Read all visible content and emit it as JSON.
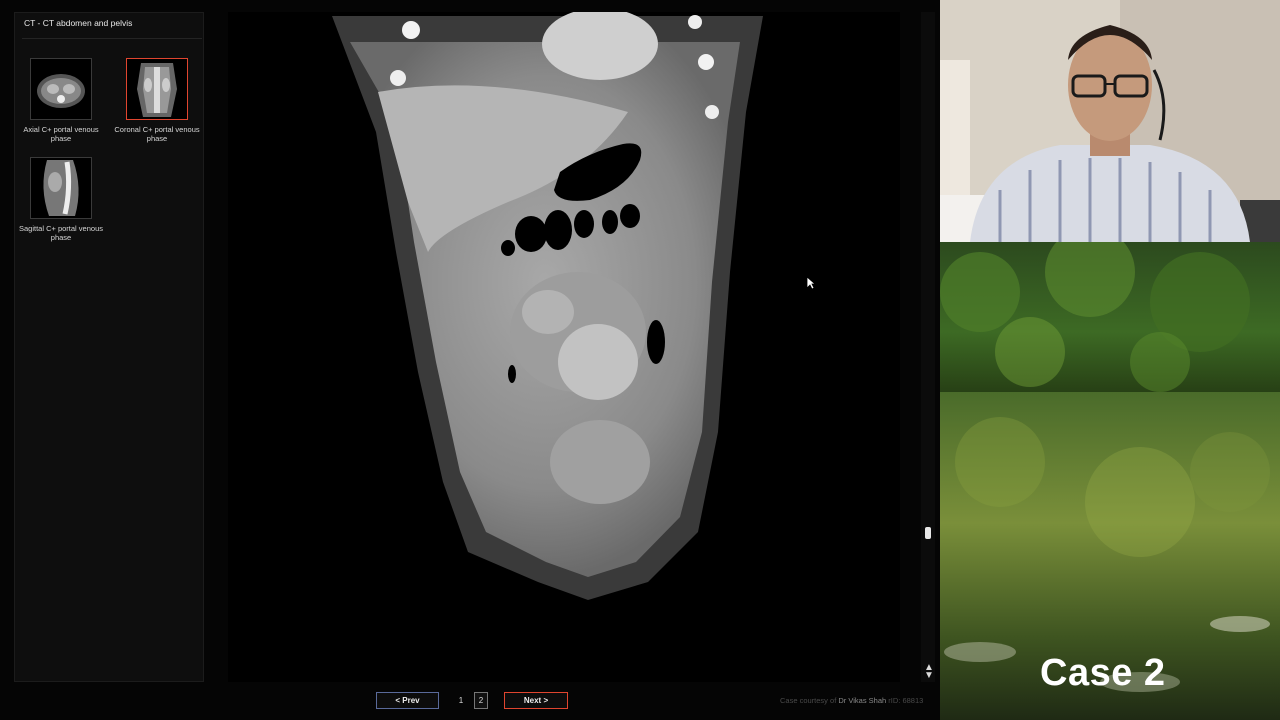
{
  "study": {
    "title": "CT - CT abdomen and pelvis"
  },
  "series": [
    {
      "caption": "Axial C+ portal venous phase",
      "selected": false
    },
    {
      "caption": "Coronal C+ portal venous phase",
      "selected": true
    },
    {
      "caption": "Sagittal C+ portal venous phase",
      "selected": false
    }
  ],
  "pager": {
    "prev_label": "<  Prev",
    "next_label": "Next  >",
    "pages": [
      "1",
      "2"
    ],
    "current_page": "2"
  },
  "courtesy": {
    "prefix": "Case courtesy of",
    "author": "Dr Vikas Shah",
    "rid": "rID: 68813"
  },
  "overlay": {
    "case_label": "Case 2"
  },
  "colors": {
    "accent": "#e0452f",
    "prev_border": "#5a6a9a"
  }
}
